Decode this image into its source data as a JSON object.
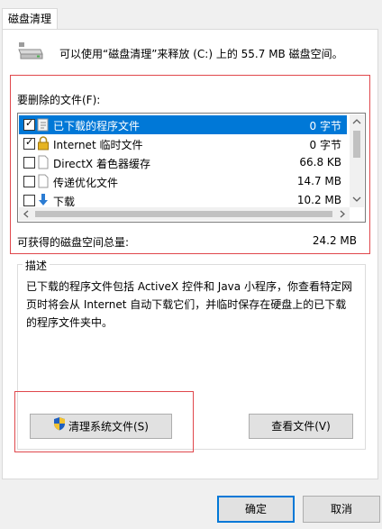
{
  "tab": {
    "label": "磁盘清理"
  },
  "header": {
    "text": "可以使用“磁盘清理”来释放  (C:) 上的 55.7 MB 磁盘空间。"
  },
  "files_section": {
    "label": "要删除的文件(F):"
  },
  "files": [
    {
      "name": "已下载的程序文件",
      "size": "0 字节",
      "checked": true,
      "selected": true,
      "icon": "folder-download-icon"
    },
    {
      "name": "Internet 临时文件",
      "size": "0 字节",
      "checked": true,
      "selected": false,
      "icon": "lock-icon"
    },
    {
      "name": "DirectX 着色器缓存",
      "size": "66.8 KB",
      "checked": false,
      "selected": false,
      "icon": "file-icon"
    },
    {
      "name": "传递优化文件",
      "size": "14.7 MB",
      "checked": false,
      "selected": false,
      "icon": "file-icon"
    },
    {
      "name": "下载",
      "size": "10.2 MB",
      "checked": false,
      "selected": false,
      "icon": "download-arrow-icon"
    }
  ],
  "total": {
    "label": "可获得的磁盘空间总量:",
    "value": "24.2 MB"
  },
  "description": {
    "title": "描述",
    "lines": [
      "已下载的程序文件包括 ActiveX 控件和 Java 小程序，你查看特定网",
      "页时将会从 Internet 自动下载它们，并临时保存在硬盘上的已下载",
      "的程序文件夹中。"
    ]
  },
  "buttons": {
    "clean_system": "清理系统文件(S)",
    "view_files": "查看文件(V)",
    "ok": "确定",
    "cancel": "取消"
  },
  "colors": {
    "selection": "#0078d7",
    "highlight_border": "#e0474c",
    "shield_blue": "#1f5fbf",
    "shield_yellow": "#f2c230"
  }
}
